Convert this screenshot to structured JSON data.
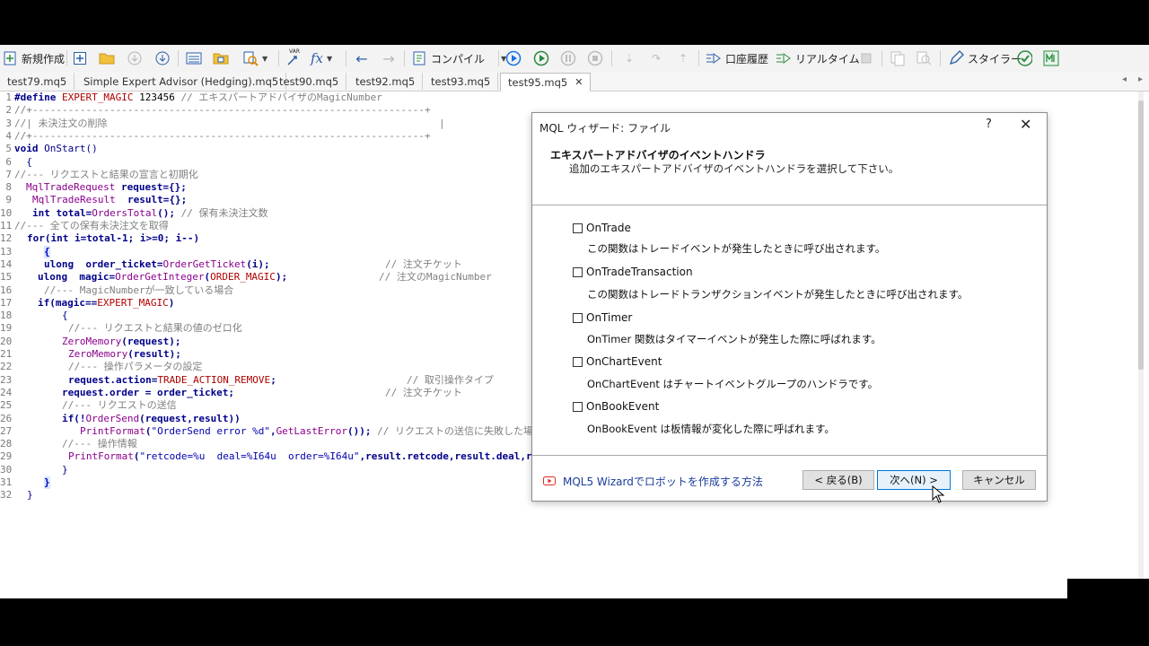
{
  "toolbar": {
    "new_label": "新規作成",
    "compile_label": "コンパイル",
    "history_label": "口座履歴",
    "realtime_label": "リアルタイム",
    "styler_label": "スタイラー",
    "var_label": "VAR",
    "fx_label": "fx"
  },
  "tabs": [
    {
      "label": "test79.mq5"
    },
    {
      "label": "Simple Expert Advisor (Hedging).mq5"
    },
    {
      "label": "test90.mq5"
    },
    {
      "label": "test92.mq5"
    },
    {
      "label": "test93.mq5"
    },
    {
      "label": "test95.mq5",
      "active": true
    }
  ],
  "code": {
    "l1_a": "#define ",
    "l1_b": "EXPERT_MAGIC",
    "l1_c": " 123456 ",
    "l1_d": "// エキスパートアドバイザのMagicNumber",
    "l2": "//+------------------------------------------------------------------+",
    "l3_a": "//| 未決注文の削除",
    "l3_b": "|",
    "l4": "//+------------------------------------------------------------------+",
    "l5_a": "void",
    "l5_b": " OnStart()",
    "l6": "  {",
    "l7": "//--- リクエストと結果の宣言と初期化",
    "l8_a": "MqlTradeRequest",
    "l8_b": " request={};",
    "l9_a": "MqlTradeResult",
    "l9_b": "  result={};",
    "l10_a": "int",
    "l10_b": " total=",
    "l10_c": "OrdersTotal",
    "l10_d": "(); ",
    "l10_e": "// 保有未決注文数",
    "l11": "//--- 全ての保有未決注文を取得",
    "l12_a": "for",
    "l12_b": "(",
    "l12_c": "int",
    "l12_d": " i=total-1; i>=0; i--)",
    "l13": "{",
    "l14_a": "ulong",
    "l14_b": "  order_ticket=",
    "l14_c": "OrderGetTicket",
    "l14_d": "(i);",
    "l14_e": "// 注文チケット",
    "l15_a": "ulong",
    "l15_b": "  magic=",
    "l15_c": "OrderGetInteger",
    "l15_d": "(",
    "l15_e": "ORDER_MAGIC",
    "l15_f": ");",
    "l15_g": "// 注文のMagicNumber",
    "l16": "//--- MagicNumberが一致している場合",
    "l17_a": "if",
    "l17_b": "(magic==",
    "l17_c": "EXPERT_MAGIC",
    "l17_d": ")",
    "l18": "{",
    "l19": "//--- リクエストと結果の値のゼロ化",
    "l20_a": "ZeroMemory",
    "l20_b": "(request);",
    "l21_a": "ZeroMemory",
    "l21_b": "(result);",
    "l22": "//--- 操作パラメータの設定",
    "l23_a": "request.action=",
    "l23_b": "TRADE_ACTION_REMOVE",
    "l23_c": ";",
    "l23_d": "// 取引操作タイプ",
    "l24_a": "request.order = order_ticket;",
    "l24_b": "// 注文チケット",
    "l25": "//--- リクエストの送信",
    "l26_a": "if",
    "l26_b": "(!",
    "l26_c": "OrderSend",
    "l26_d": "(request,result))",
    "l27_a": "PrintFormat",
    "l27_b": "(",
    "l27_c": "\"OrderSend error %d\"",
    "l27_d": ",",
    "l27_e": "GetLastError",
    "l27_f": "()); ",
    "l27_g": "// リクエストの送信に失敗した場合",
    "l28": "//--- 操作情報",
    "l29_a": "PrintFormat",
    "l29_b": "(",
    "l29_c": "\"retcode=%u  deal=%I64u  order=%I64u\"",
    "l29_d": ",result.retcode,result.deal,r",
    "l30": "}",
    "l31": "}",
    "l32": "}"
  },
  "dialog": {
    "title": "MQL ウィザード: ファイル",
    "help": "?",
    "close": "✕",
    "heading": "エキスパートアドバイザのイベントハンドラ",
    "subheading": "追加のエキスパートアドバイザのイベントハンドラを選択して下さい。",
    "options": [
      {
        "label": "OnTrade",
        "desc": "この関数はトレードイベントが発生したときに呼び出されます。"
      },
      {
        "label": "OnTradeTransaction",
        "desc": "この関数はトレードトランザクションイベントが発生したときに呼び出されます。"
      },
      {
        "label": "OnTimer",
        "desc": "OnTimer 関数はタイマーイベントが発生した際に呼ばれます。"
      },
      {
        "label": "OnChartEvent",
        "desc": "OnChartEvent はチャートイベントグループのハンドラです。"
      },
      {
        "label": "OnBookEvent",
        "desc": "OnBookEvent は板情報が変化した際に呼ばれます。"
      }
    ],
    "link": "MQL5 Wizardでロボットを作成する方法",
    "back": "< 戻る(B)",
    "next": "次へ(N) >",
    "cancel": "キャンセル"
  },
  "colors": {
    "accent": "#0078d7",
    "keyword": "#00008b",
    "type": "#8b008b",
    "macro": "#b00000",
    "comment": "#808080"
  }
}
